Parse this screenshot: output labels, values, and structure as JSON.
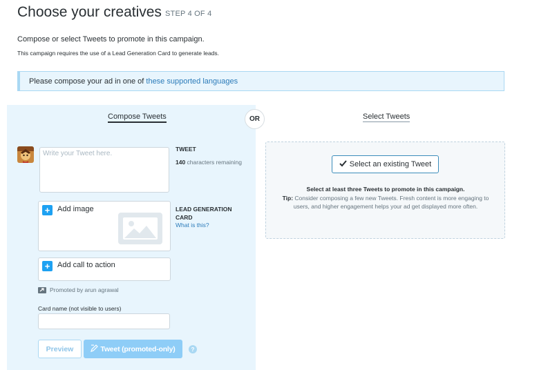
{
  "header": {
    "title": "Choose your creatives",
    "step": "STEP 4 OF 4",
    "intro": "Compose or select Tweets to promote in this campaign.",
    "intro_small": "This campaign requires the use of a Lead Generation Card to generate leads."
  },
  "notice": {
    "text": "Please compose your ad in one of ",
    "link": "these supported languages"
  },
  "tabs": {
    "compose": "Compose Tweets",
    "or": "OR",
    "select": "Select Tweets"
  },
  "compose": {
    "tweet_placeholder": "Write your Tweet here.",
    "tweet_label": "TWEET",
    "chars_count": "140",
    "chars_suffix": " characters remaining",
    "add_image": "Add image",
    "card_label": "LEAD GENERATION CARD",
    "what_is_this": "What is this?",
    "add_cta": "Add call to action",
    "promoted_by": "Promoted by arun agrawal",
    "card_name_label": "Card name (not visible to users)",
    "card_name_value": "",
    "preview": "Preview",
    "tweet_button": "Tweet (promoted-only)",
    "help_glyph": "?"
  },
  "select": {
    "button": "Select an existing Tweet",
    "hint_strong": "Select at least three Tweets to promote in this campaign.",
    "tip_label": "Tip:",
    "tip_text": " Consider composing a few new Tweets. Fresh content is more engaging to users, and higher engagement helps your ad get displayed more often."
  },
  "icons": {
    "plus": "plus-icon",
    "image": "image-placeholder-icon",
    "check": "checkmark-icon",
    "promoted": "promoted-icon",
    "help": "help-icon",
    "compose": "compose-pencil-icon"
  },
  "colors": {
    "accent": "#1da1f2",
    "link": "#2b7bb9",
    "panel_bg": "#e8f5fd",
    "disabled_button": "#8ecdf7"
  }
}
